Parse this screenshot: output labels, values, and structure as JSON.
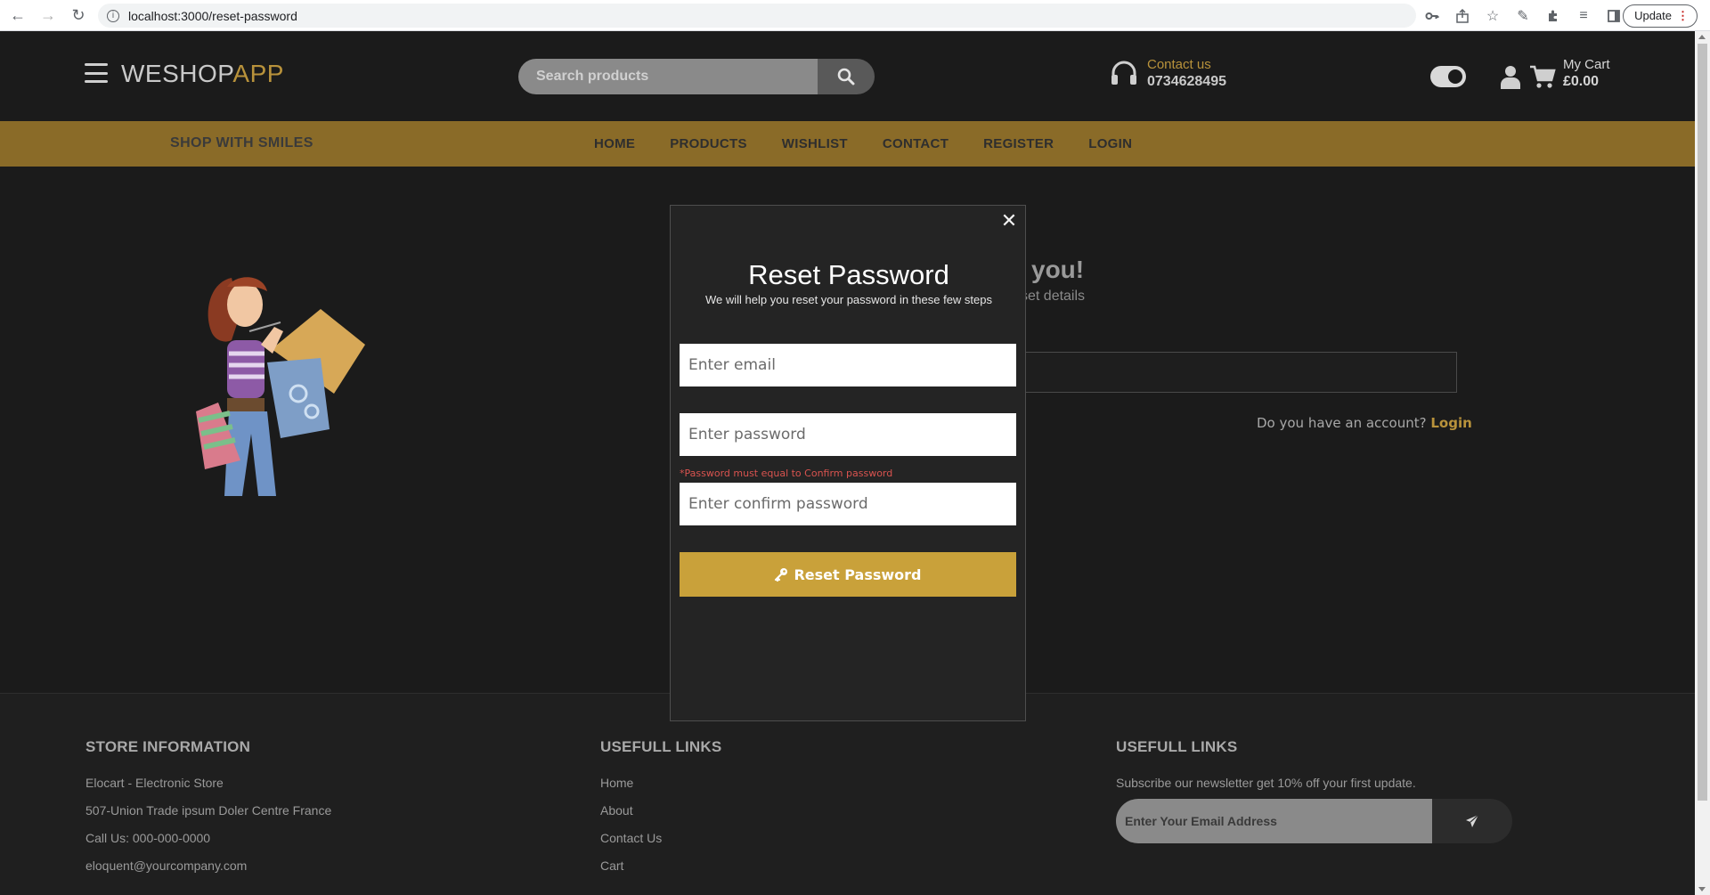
{
  "browser": {
    "url": "localhost:3000/reset-password",
    "update_label": "Update"
  },
  "header": {
    "logo_main": "WESHOP",
    "logo_accent": "APP",
    "search_placeholder": "Search products",
    "contact_label": "Contact us",
    "contact_phone": "0734628495",
    "cart_label": "My Cart",
    "cart_total": "£0.00"
  },
  "nav": {
    "tagline": "SHOP WITH SMILES",
    "links": [
      "HOME",
      "PRODUCTS",
      "WISHLIST",
      "CONTACT",
      "REGISTER",
      "LOGIN"
    ]
  },
  "background": {
    "heading_fragment": "you!",
    "sub_fragment": "set details",
    "account_question": "Do you have an account?",
    "login_link": "Login"
  },
  "modal": {
    "title": "Reset Password",
    "subtitle": "We will help you reset your password in these few steps",
    "email_placeholder": "Enter email",
    "password_placeholder": "Enter password",
    "error_text": "*Password must equal to Confirm password",
    "confirm_placeholder": "Enter confirm password",
    "button_label": "Reset Password"
  },
  "footer": {
    "col1": {
      "title": "STORE INFORMATION",
      "items": [
        "Elocart - Electronic Store",
        "507-Union Trade ipsum Doler Centre France",
        "Call Us: 000-000-0000",
        "eloquent@yourcompany.com"
      ]
    },
    "col2": {
      "title": "USEFULL LINKS",
      "items": [
        "Home",
        "About",
        "Contact Us",
        "Cart"
      ]
    },
    "col3": {
      "title": "USEFULL LINKS",
      "text": "Subscribe our newsletter get 10% off your first update.",
      "email_placeholder": "Enter Your Email Address"
    }
  },
  "colors": {
    "accent": "#b8923b",
    "nav_bar": "#8a6b28",
    "button": "#c9a13a",
    "error": "#d9534f",
    "background": "#1b1b1b"
  }
}
